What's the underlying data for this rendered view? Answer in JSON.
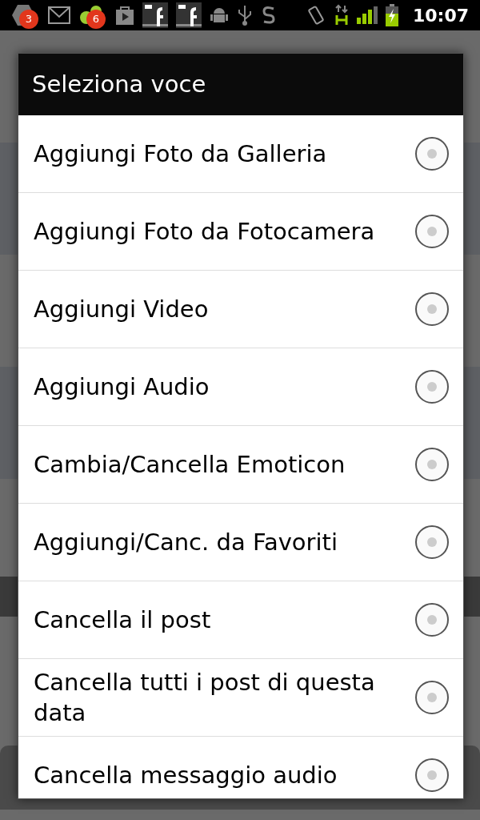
{
  "status_bar": {
    "notifications": [
      {
        "kind": "badge",
        "count": "3"
      },
      {
        "kind": "mail"
      },
      {
        "kind": "badge",
        "count": "6"
      },
      {
        "kind": "store"
      },
      {
        "kind": "facebook"
      },
      {
        "kind": "facebook"
      },
      {
        "kind": "android"
      },
      {
        "kind": "usb"
      },
      {
        "kind": "s"
      }
    ],
    "time": "10:07"
  },
  "dialog": {
    "title": "Seleziona voce",
    "items": [
      {
        "label": "Aggiungi Foto da Galleria",
        "selected": false
      },
      {
        "label": "Aggiungi Foto da Fotocamera",
        "selected": false
      },
      {
        "label": "Aggiungi Video",
        "selected": false
      },
      {
        "label": "Aggiungi Audio",
        "selected": false
      },
      {
        "label": "Cambia/Cancella Emoticon",
        "selected": false
      },
      {
        "label": "Aggiungi/Canc. da Favoriti",
        "selected": false
      },
      {
        "label": "Cancella il post",
        "selected": false
      },
      {
        "label": "Cancella tutti i post di questa data",
        "selected": false
      },
      {
        "label": "Cancella messaggio audio",
        "selected": false
      }
    ]
  }
}
